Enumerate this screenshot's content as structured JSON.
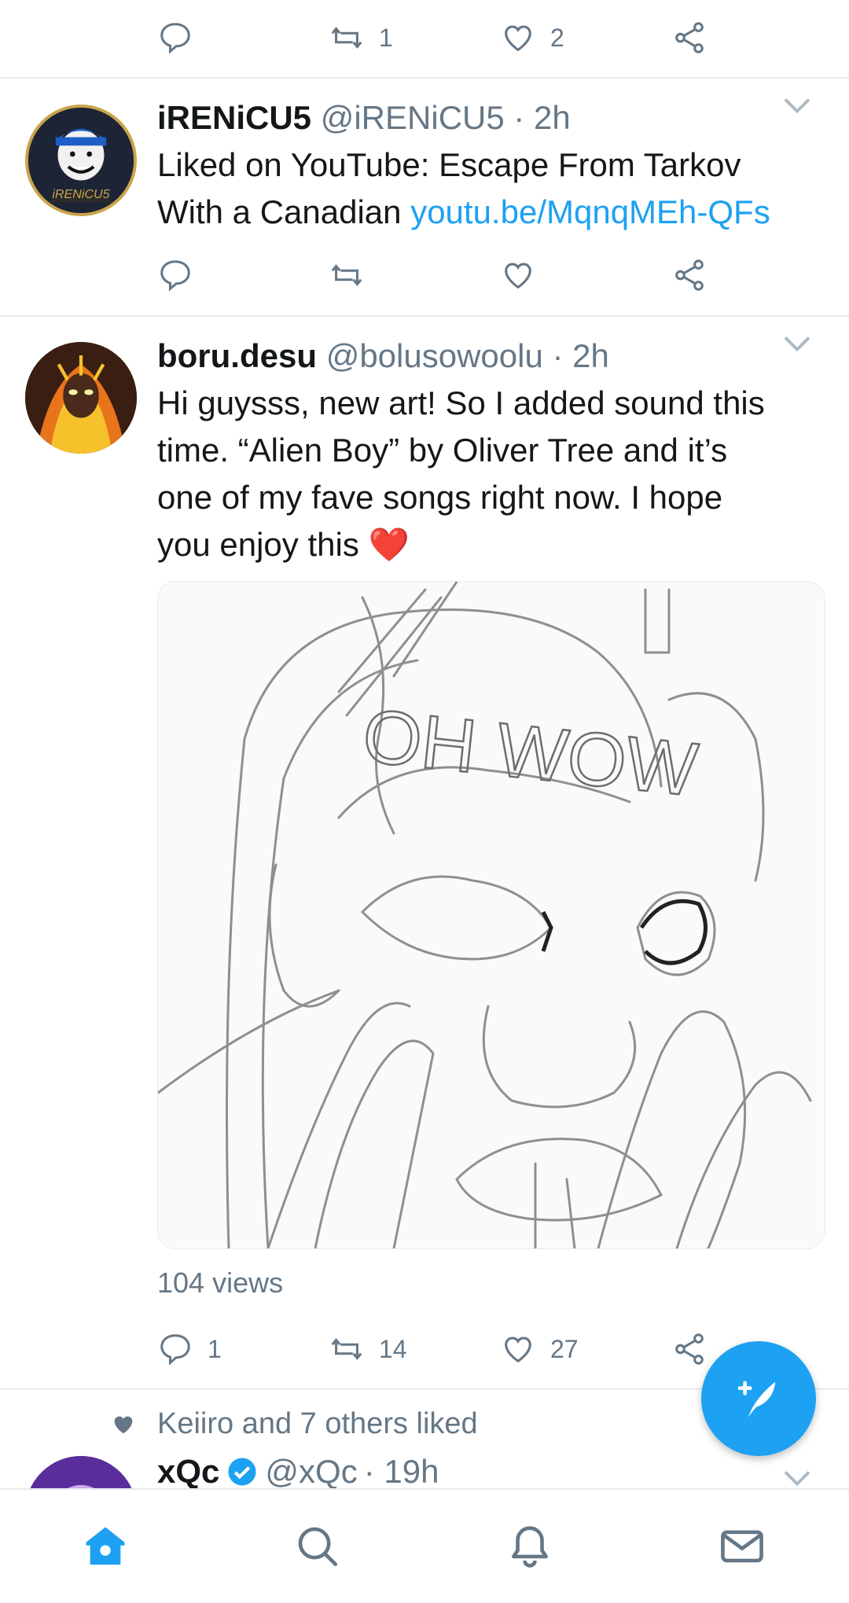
{
  "top_actions": {
    "reply_count": "",
    "retweet_count": "1",
    "like_count": "2"
  },
  "tweets": [
    {
      "name": "iRENiCU5",
      "handle": "@iRENiCU5",
      "time": "· 2h",
      "text_line1": "Liked on YouTube: Escape From Tarkov",
      "text_line2": "With a Canadian ",
      "link": "youtu.be/MqnqMEh-QFs",
      "reply_count": "",
      "retweet_count": "",
      "like_count": "",
      "avatar_text": "iRENiCU5"
    },
    {
      "name": "boru.desu",
      "handle": "@bolusowoolu",
      "time": "· 2h",
      "lines": [
        "Hi guysss, new art! So I added sound this",
        "time. “Alien Boy” by Oliver Tree and it’s",
        "one of my fave songs right now. I hope",
        "you enjoy this "
      ],
      "emoji": "❤️",
      "media_text": "OH WOW",
      "views": "104 views",
      "reply_count": "1",
      "retweet_count": "14",
      "like_count": "27"
    }
  ],
  "liked_banner": "Keiiro and 7 others liked",
  "next_tweet": {
    "name": "xQc",
    "handle": "@xQc",
    "time": "· 19h"
  },
  "nav": [
    "home",
    "search",
    "notifications",
    "messages"
  ],
  "colors": {
    "accent": "#1da1f2",
    "muted": "#657786",
    "divider": "#e6ecf0"
  }
}
